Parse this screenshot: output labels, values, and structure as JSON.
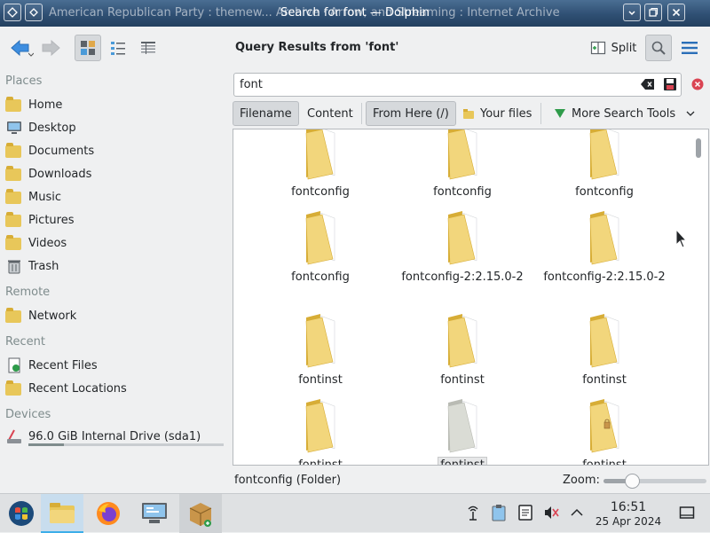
{
  "window": {
    "background_title": "American Republican Party : themew... Archive · Arrow, and Streaming : Internet Archive",
    "title": "Search for font — Dolphin"
  },
  "toolbar": {
    "view_title": "Query Results from 'font'",
    "split_label": "Split"
  },
  "sidebar": {
    "places_header": "Places",
    "places": [
      {
        "label": "Home",
        "icon": "home-folder-icon"
      },
      {
        "label": "Desktop",
        "icon": "desktop-icon"
      },
      {
        "label": "Documents",
        "icon": "documents-folder-icon"
      },
      {
        "label": "Downloads",
        "icon": "downloads-folder-icon"
      },
      {
        "label": "Music",
        "icon": "music-folder-icon"
      },
      {
        "label": "Pictures",
        "icon": "pictures-folder-icon"
      },
      {
        "label": "Videos",
        "icon": "videos-folder-icon"
      },
      {
        "label": "Trash",
        "icon": "trash-icon"
      }
    ],
    "remote_header": "Remote",
    "remote": [
      {
        "label": "Network",
        "icon": "network-folder-icon"
      }
    ],
    "recent_header": "Recent",
    "recent": [
      {
        "label": "Recent Files",
        "icon": "recent-files-icon"
      },
      {
        "label": "Recent Locations",
        "icon": "recent-locations-icon"
      }
    ],
    "devices_header": "Devices",
    "devices": [
      {
        "label": "96.0 GiB Internal Drive (sda1)",
        "icon": "hard-drive-icon",
        "usage_fraction": 0.18
      }
    ]
  },
  "search": {
    "query": "font",
    "options": {
      "filename": "Filename",
      "content": "Content",
      "from_here": "From Here (/)",
      "your_files": "Your files",
      "more_tools": "More Search Tools"
    }
  },
  "files": [
    {
      "name": "fontconfig",
      "type": "folder"
    },
    {
      "name": "fontconfig",
      "type": "folder"
    },
    {
      "name": "fontconfig",
      "type": "folder"
    },
    {
      "name": "fontconfig",
      "type": "folder"
    },
    {
      "name": "fontconfig-2:2.15.0-2",
      "type": "folder"
    },
    {
      "name": "fontconfig-2:2.15.0-2",
      "type": "folder"
    },
    {
      "name": "fontinst",
      "type": "folder"
    },
    {
      "name": "fontinst",
      "type": "folder"
    },
    {
      "name": "fontinst",
      "type": "folder"
    },
    {
      "name": "fontinst",
      "type": "folder"
    },
    {
      "name": "fontinst",
      "type": "folder",
      "selected": true,
      "style": "grey"
    },
    {
      "name": "fontinst",
      "type": "folder",
      "emblem": "lock-emblem-icon"
    }
  ],
  "status": {
    "text": "fontconfig (Folder)",
    "zoom_label": "Zoom:",
    "zoom_fraction": 0.28
  },
  "taskbar": {
    "apps": [
      "application-launcher-icon",
      "dolphin-file-manager-icon",
      "firefox-icon",
      "system-settings-icon",
      "package-manager-icon"
    ],
    "tray": [
      "network-icon",
      "clipboard-icon",
      "notes-icon",
      "audio-muted-icon",
      "expand-tray-icon"
    ],
    "clock_time": "16:51",
    "clock_date": "25 Apr 2024"
  },
  "colors": {
    "accent": "#3daee9",
    "folder_yellow": "#e8c75a",
    "close_red": "#da4453"
  }
}
